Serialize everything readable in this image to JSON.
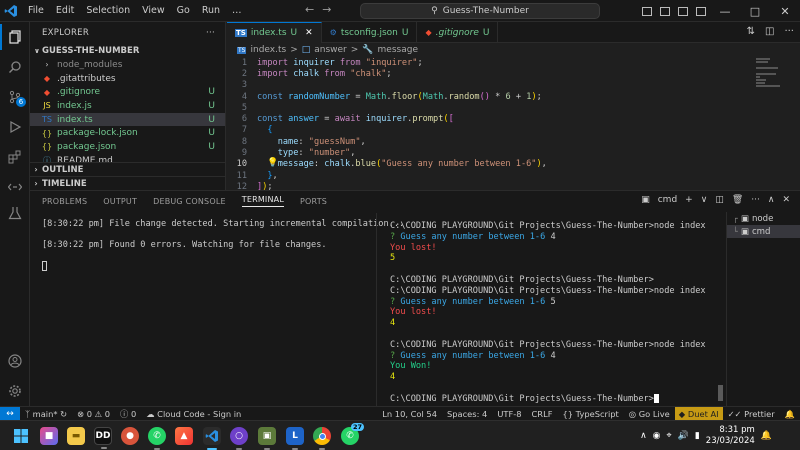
{
  "titlebar": {
    "menu": [
      "File",
      "Edit",
      "Selection",
      "View",
      "Go",
      "Run",
      "…"
    ],
    "search": "Guess-The-Number"
  },
  "activitybar": {
    "source_control_badge": "6"
  },
  "sidebar": {
    "header": "EXPLORER",
    "folder": "GUESS-THE-NUMBER",
    "items": [
      {
        "label": "node_modules",
        "status": "",
        "color": "#8b8b8b"
      },
      {
        "label": ".gitattributes",
        "status": "",
        "color": "#cccccc"
      },
      {
        "label": ".gitignore",
        "status": "U",
        "color": "#73c991"
      },
      {
        "label": "index.js",
        "status": "U",
        "color": "#73c991"
      },
      {
        "label": "index.ts",
        "status": "U",
        "color": "#73c991"
      },
      {
        "label": "package-lock.json",
        "status": "U",
        "color": "#73c991"
      },
      {
        "label": "package.json",
        "status": "U",
        "color": "#73c991"
      },
      {
        "label": "README.md",
        "status": "",
        "color": "#cccccc"
      }
    ],
    "outline": "OUTLINE",
    "timeline": "TIMELINE"
  },
  "tabs": [
    {
      "label": "index.ts",
      "status": "U"
    },
    {
      "label": "tsconfig.json",
      "status": "U"
    },
    {
      "label": ".gitignore",
      "status": "U"
    }
  ],
  "breadcrumb": {
    "file": "index.ts",
    "sep1": ">",
    "sep2": ">",
    "symbol1": "answer",
    "symbol2": "message"
  },
  "code": {
    "lines": [
      "1",
      "2",
      "3",
      "4",
      "5",
      "6",
      "7",
      "8",
      "9",
      "10",
      "11",
      "12"
    ],
    "current_line": "10"
  },
  "panel": {
    "tabs": [
      "PROBLEMS",
      "OUTPUT",
      "DEBUG CONSOLE",
      "TERMINAL",
      "PORTS"
    ],
    "shell": "cmd",
    "left": {
      "line1": "[8:30:22 pm] File change detected. Starting incremental compilation...",
      "line2": "[8:30:22 pm] Found 0 errors. Watching for file changes."
    },
    "right": {
      "prompt_cmd": "C:\\CODING PLAYGROUND\\Git Projects\\Guess-The-Number>node index",
      "prompt_bare": "C:\\CODING PLAYGROUND\\Git Projects\\Guess-The-Number>",
      "question_mark": "?",
      "question": "Guess any number between 1-6",
      "run1_answer": "4",
      "run1_result": "You lost!",
      "run1_number": "5",
      "run2_answer": "5",
      "run2_result": "You lost!",
      "run2_number": "4",
      "run3_answer": "4",
      "run3_result": "You Won!",
      "run3_number": "4"
    },
    "terminals": [
      "node",
      "cmd"
    ]
  },
  "statusbar": {
    "branch": "main*",
    "errors": "0",
    "warnings": "0",
    "infos": "0",
    "cloud": "Cloud Code - Sign in",
    "position": "Ln 10, Col 54",
    "spaces": "Spaces: 4",
    "encoding": "UTF-8",
    "eol": "CRLF",
    "language": "TypeScript",
    "golive": "Go Live",
    "duet": "Duet AI",
    "prettier": "Prettier"
  },
  "taskbar": {
    "whatsapp_badge": "27",
    "time": "8:31 pm",
    "date": "23/03/2024"
  }
}
